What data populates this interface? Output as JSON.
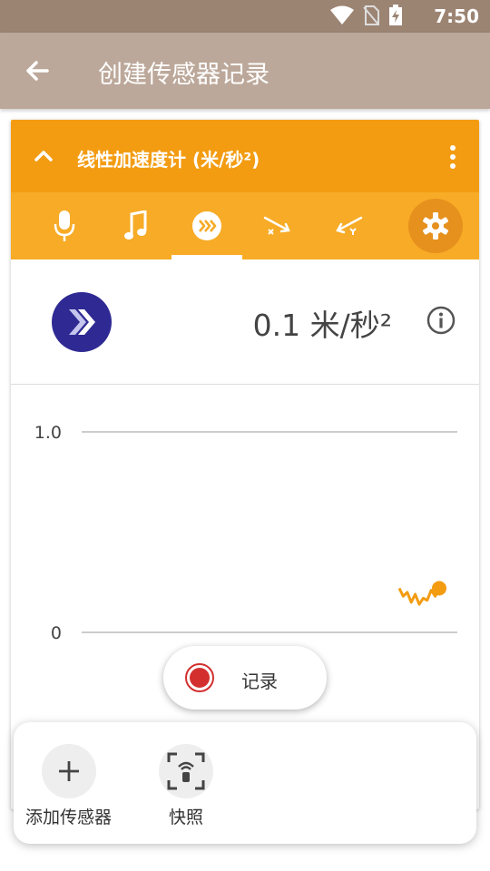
{
  "status_bar": {
    "time": "7:50"
  },
  "app_bar": {
    "title": "创建传感器记录"
  },
  "sensor_card": {
    "title": "线性加速度计 (米/秒²)",
    "tabs": [
      {
        "icon": "microphone-icon"
      },
      {
        "icon": "music-note-icon"
      },
      {
        "icon": "linear-acceleration-icon",
        "selected": true
      },
      {
        "icon": "acceleration-x-icon"
      },
      {
        "icon": "acceleration-y-icon"
      }
    ],
    "reading": "0.1 米/秒²"
  },
  "chart_data": {
    "type": "line",
    "y_ticks": [
      "1.0",
      "0"
    ],
    "ylim": [
      0,
      1
    ],
    "series": [
      {
        "color": "#f39c12",
        "points": [
          {
            "x": 0,
            "y": 0.22
          },
          {
            "x": 1,
            "y": 0.18
          },
          {
            "x": 2,
            "y": 0.2
          },
          {
            "x": 3,
            "y": 0.15
          },
          {
            "x": 4,
            "y": 0.19
          },
          {
            "x": 5,
            "y": 0.14
          },
          {
            "x": 6,
            "y": 0.17
          },
          {
            "x": 7,
            "y": 0.16
          },
          {
            "x": 8,
            "y": 0.21
          },
          {
            "x": 9,
            "y": 0.18
          },
          {
            "x": 10,
            "y": 0.22
          }
        ]
      }
    ]
  },
  "record_button": {
    "label": "记录"
  },
  "bottom_actions": {
    "add_sensor_label": "添加传感器",
    "snapshot_label": "快照"
  },
  "colors": {
    "accent": "#f39c12",
    "tab_bar": "#f7ab26",
    "app_bar": "#bca89a",
    "badge": "#2f2a93",
    "record": "#d32f2f"
  }
}
